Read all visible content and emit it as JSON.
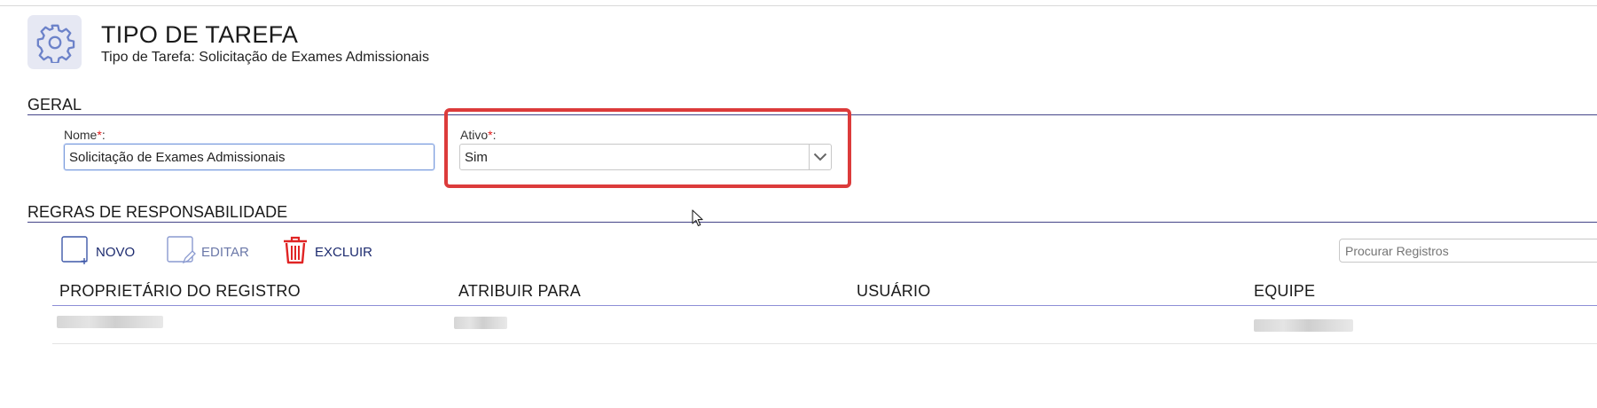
{
  "header": {
    "title": "TIPO DE TAREFA",
    "subtitle": "Tipo de Tarefa: Solicitação de Exames Admissionais",
    "icon": "gear-icon"
  },
  "general": {
    "section_title": "GERAL",
    "name_label": "Nome",
    "name_value": "Solicitação de Exames Admissionais",
    "active_label": "Ativo",
    "active_value": "Sim",
    "required_mark": "*",
    "colon": ":"
  },
  "rules": {
    "section_title": "REGRAS DE RESPONSABILIDADE",
    "toolbar": {
      "new_label": "NOVO",
      "edit_label": "EDITAR",
      "delete_label": "EXCLUIR"
    },
    "search_placeholder": "Procurar Registros",
    "columns": [
      "PROPRIETÁRIO DO REGISTRO",
      "ATRIBUIR PARA",
      "USUÁRIO",
      "EQUIPE"
    ]
  },
  "colors": {
    "accent": "#1d2b6f",
    "required": "#e01919",
    "highlight": "#dc3b3b",
    "section_rule": "#444488"
  }
}
